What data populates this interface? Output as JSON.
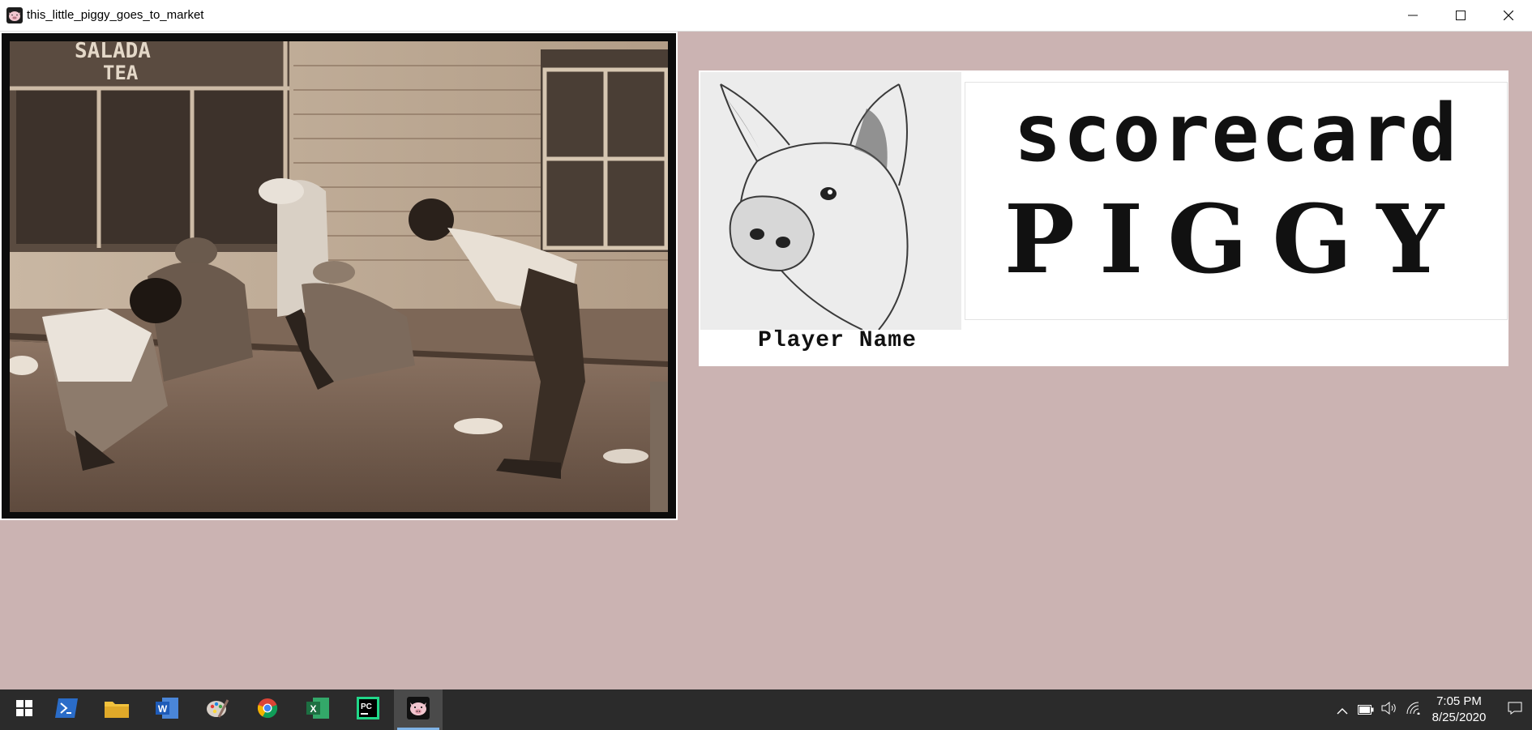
{
  "window": {
    "title": "this_little_piggy_goes_to_market",
    "minimize_icon": "minimize-icon",
    "maximize_icon": "maximize-icon",
    "close_icon": "close-icon"
  },
  "photo": {
    "icon": "vintage-street-photo",
    "store_sign": "SALADA\nTEA"
  },
  "scorecard": {
    "player_label": "Player Name",
    "title_line1": "scorecard",
    "title_line2": "PIGGY",
    "pig_icon": "pig-sketch-image"
  },
  "taskbar": {
    "apps": [
      {
        "name": "start",
        "icon": "windows-icon"
      },
      {
        "name": "powershell",
        "icon": "powershell-icon"
      },
      {
        "name": "file-explorer",
        "icon": "folder-icon"
      },
      {
        "name": "word",
        "icon": "word-icon"
      },
      {
        "name": "paint",
        "icon": "paint-icon"
      },
      {
        "name": "chrome",
        "icon": "chrome-icon"
      },
      {
        "name": "excel",
        "icon": "excel-icon"
      },
      {
        "name": "pycharm",
        "icon": "pycharm-icon"
      },
      {
        "name": "piggy-app",
        "icon": "pig-app-icon"
      }
    ],
    "tray_icons": [
      "chevron-up-icon",
      "battery-icon",
      "volume-icon",
      "wifi-icon",
      "notification-icon"
    ],
    "time": "7:05 PM",
    "date": "8/25/2020"
  },
  "colors": {
    "background": "#cbb3b2",
    "taskbar": "#2b2b2b"
  }
}
